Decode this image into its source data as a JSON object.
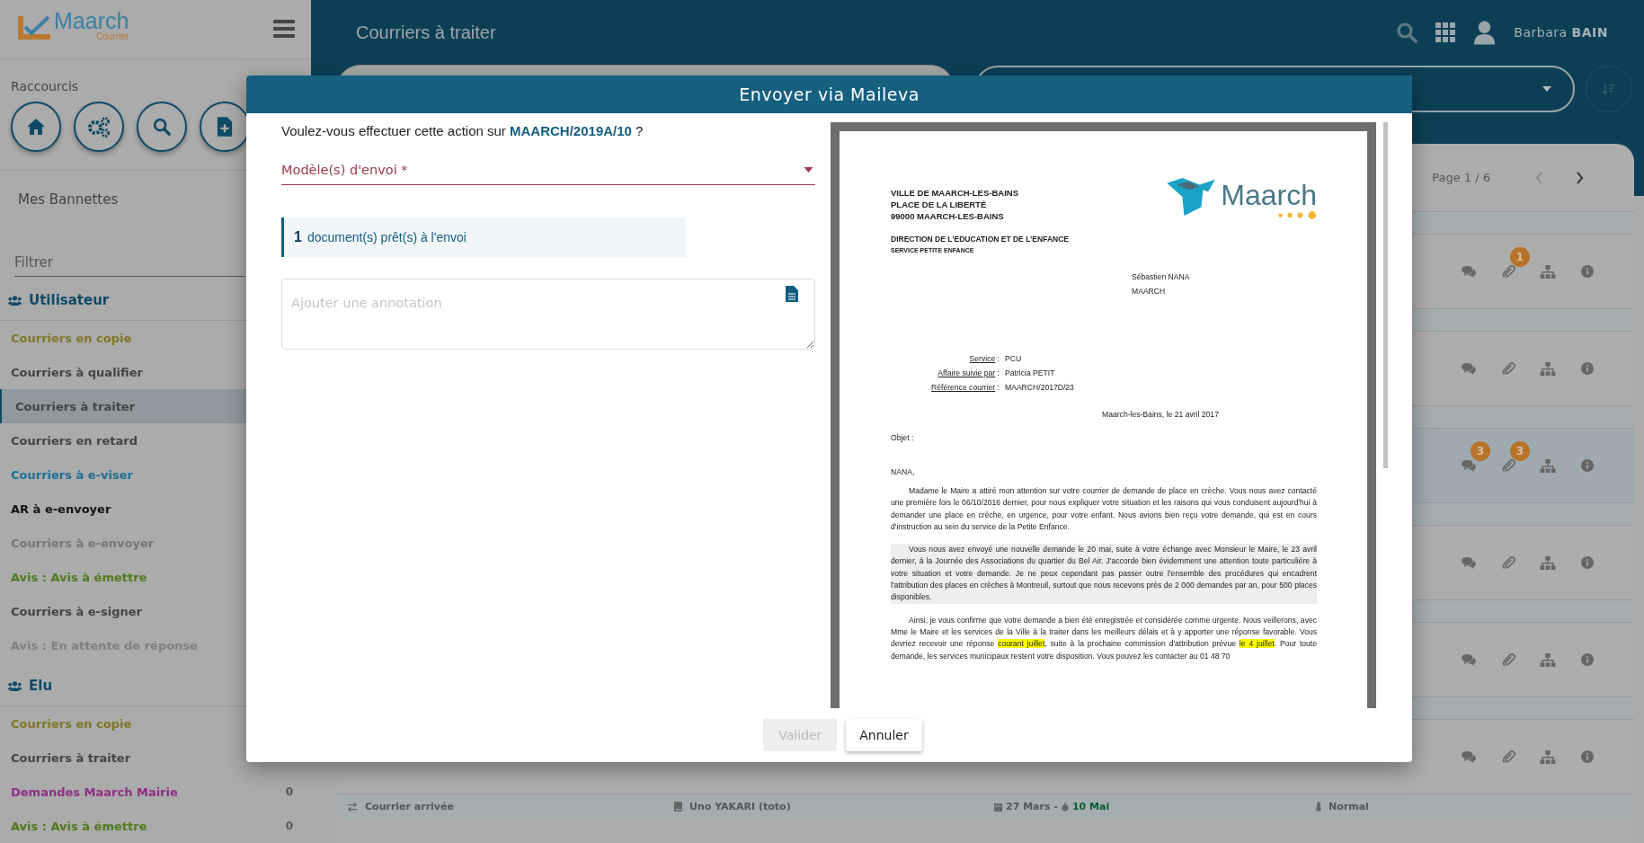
{
  "app": {
    "logo_name": "Maarch",
    "logo_sub": "Courrier"
  },
  "sidebar": {
    "shortcuts_title": "Raccourcis",
    "shortcuts": [
      {
        "kind": "home"
      },
      {
        "kind": "settings"
      },
      {
        "kind": "search"
      },
      {
        "kind": "new-document"
      }
    ],
    "baskets_title": "Mes Bannettes",
    "filter_placeholder": "Filtrer",
    "groups": [
      {
        "name": "Utilisateur",
        "items": [
          {
            "label": "Courriers en copie",
            "color": "#7d7628",
            "selected": false
          },
          {
            "label": "Courriers à qualifier",
            "color": "#444444",
            "selected": false
          },
          {
            "label": "Courriers à traiter",
            "color": "#444444",
            "selected": true
          },
          {
            "label": "Courriers en retard",
            "color": "#444444",
            "selected": false
          },
          {
            "label": "Courriers à e-viser",
            "color": "#1f6f93",
            "selected": false
          },
          {
            "label": "AR à e-envoyer",
            "color": "#111111",
            "selected": false
          },
          {
            "label": "Courriers à e-envoyer",
            "color": "#777777",
            "selected": false
          },
          {
            "label": "Avis : Avis à émettre",
            "color": "#4f7a1e",
            "selected": false
          },
          {
            "label": "Courriers à e-signer",
            "color": "#444444",
            "selected": false
          },
          {
            "label": "Avis : En attente de réponse",
            "color": "#808080",
            "selected": false
          }
        ]
      },
      {
        "name": "Elu",
        "items": [
          {
            "label": "Courriers en copie",
            "color": "#7d7628",
            "selected": false
          },
          {
            "label": "Courriers à traiter",
            "color": "#444444",
            "selected": false
          },
          {
            "label": "Demandes Maarch Mairie",
            "color": "#8e2f86",
            "selected": false,
            "count": "0"
          },
          {
            "label": "Avis : Avis à émettre",
            "color": "#4f7a1e",
            "selected": false,
            "count": "0"
          }
        ]
      }
    ]
  },
  "header": {
    "title": "Courriers à traiter",
    "user": "Barbara **BAIN**"
  },
  "list": {
    "pagination": "Page 1 / 6",
    "rows": [
      {
        "selected": false,
        "attachments_badge": "1"
      },
      {
        "selected": false
      },
      {
        "selected": true,
        "notes_badge": "3",
        "attachments_badge": "3"
      },
      {
        "selected": false
      },
      {
        "selected": false
      },
      {
        "selected": false
      }
    ],
    "info_strip": {
      "type": "Courrier arrivée",
      "contact": "Uno YAKARI (toto)",
      "date": "27 Mars -",
      "deadline": "10 Mai",
      "priority": "Normal"
    }
  },
  "modal": {
    "title": "Envoyer via Maileva",
    "question": "Voulez-vous effectuer cette action sur **MAARCH/2019A/10** ?",
    "template_label": "Modèle(s) d'envoi *",
    "documents_count": "1",
    "documents_text": "document(s) prêt(s) à l'envoi",
    "annotation_placeholder": "Ajouter une annotation",
    "buttons": [
      {
        "label": "Valider",
        "disabled": true
      },
      {
        "label": "Annuler",
        "disabled": false
      }
    ],
    "letter": {
      "sender": [
        "VILLE DE MAARCH-LES-BAINS",
        "PLACE DE LA LIBERTÉ",
        "99000 MAARCH-LES-BAINS"
      ],
      "department": "DIRECTION DE L'EDUCATION ET DE L'ENFANCE",
      "service": "SERVICE PETITE ENFANCE",
      "logo_text": "Maarch",
      "recipient": [
        "Sébastien NANA",
        "MAARCH"
      ],
      "fields": [
        {
          "label": "Service",
          "colon": ":",
          "value": "PCU"
        },
        {
          "label": "Affaire suivie par",
          "colon": ":",
          "value": "Patricia PETIT"
        },
        {
          "label": "Référence courrier",
          "colon": ":",
          "value": "MAARCH/2017D/23"
        }
      ],
      "date_line": "Maarch-les-Bains, le 21 avril 2017",
      "subject": "Objet :",
      "salutation": "NANA,",
      "paragraphs": [
        {
          "shaded": false,
          "segments": [
            {
              "text": "Madame le Maire a attiré mon attention sur votre courrier de demande de place en crèche. Vous nous avez contacté une première fois le 06/10/2016 dernier, pour nous expliquer votre situation et les raisons qui vous conduisent aujourd'hui à demander une place en crèche, en urgence, pour votre enfant. Nous avions bien reçu votre demande, qui est en cours d'instruction au sein du service de la Petite Enfance.",
              "highlight": false
            }
          ]
        },
        {
          "shaded": true,
          "segments": [
            {
              "text": "Vous nous avez envoyé une nouvelle demande le 20 mai, suite à votre échange avec Monsieur le Maire, le 23 avril dernier, à la Journée des Associations du quartier du Bel Air. J'accorde bien évidemment une attention toute particulière à votre situation et votre demande. Je ne peux cependant pas passer outre l'ensemble des procédures qui encadrent l'attribution des places en crèches à Montreuil, surtout que nous recevons près de 2 000 demandes par an, pour 500 places disponibles.",
              "highlight": false
            }
          ]
        },
        {
          "shaded": false,
          "segments": [
            {
              "text": "Ainsi, je vous confirme que votre demande a bien été enregistrée et considérée comme urgente. Nous veillerons, avec Mme le Maire et les services de la Ville à la traiter dans les meilleurs délais et à y apporter une réponse favorable. Vous devriez recevoir une réponse ",
              "highlight": false
            },
            {
              "text": "courant juillet",
              "highlight": true
            },
            {
              "text": ", suite à la prochaine commission d'attribution prévue ",
              "highlight": false
            },
            {
              "text": "le 4 juillet",
              "highlight": true
            },
            {
              "text": ". Pour toute demande, les services municipaux restent votre disposition. Vous pouvez les contacter au 01 48 70",
              "highlight": false
            }
          ]
        }
      ]
    }
  }
}
